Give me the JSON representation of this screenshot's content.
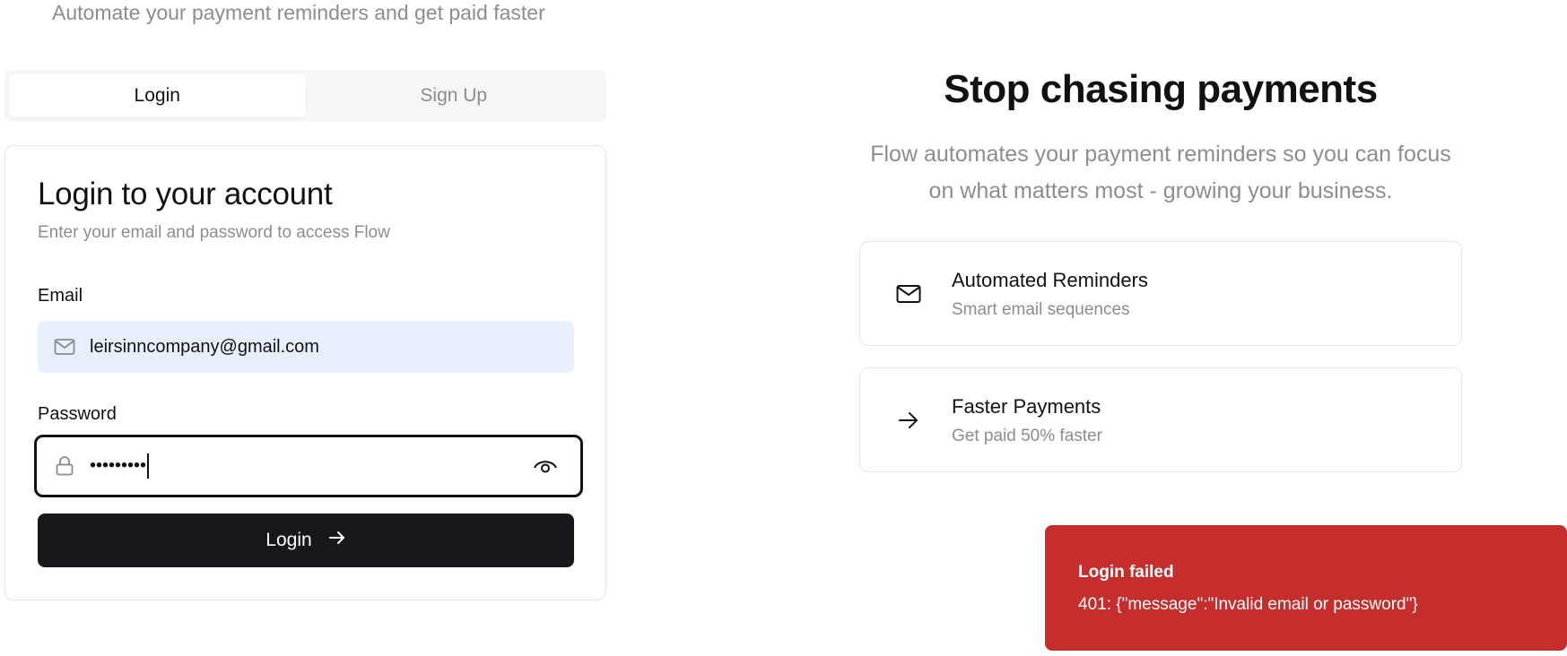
{
  "header": {
    "tagline": "Automate your payment reminders and get paid faster"
  },
  "tabs": [
    {
      "label": "Login",
      "active": true
    },
    {
      "label": "Sign Up",
      "active": false
    }
  ],
  "login_card": {
    "title": "Login to your account",
    "description": "Enter your email and password to access Flow",
    "email": {
      "label": "Email",
      "value": "leirsinncompany@gmail.com",
      "icon": "mail-icon"
    },
    "password": {
      "label": "Password",
      "masked_value": "•••••••••",
      "icon": "lock-icon",
      "toggle_icon": "eye-icon"
    },
    "submit_label": "Login",
    "submit_icon": "arrow-right-icon"
  },
  "hero": {
    "title": "Stop chasing payments",
    "description": "Flow automates your payment reminders so you can focus on what matters most - growing your business."
  },
  "features": [
    {
      "title": "Automated Reminders",
      "subtitle": "Smart email sequences",
      "icon": "mail-icon"
    },
    {
      "title": "Faster Payments",
      "subtitle": "Get paid 50% faster",
      "icon": "arrow-right-icon"
    }
  ],
  "toast": {
    "title": "Login failed",
    "message": "401: {\"message\":\"Invalid email or password\"}",
    "color": "#c62d2d"
  },
  "colors": {
    "primary_button": "#17181c",
    "muted_text": "#8d8d8d",
    "email_autofill_bg": "#e8f0fe"
  }
}
